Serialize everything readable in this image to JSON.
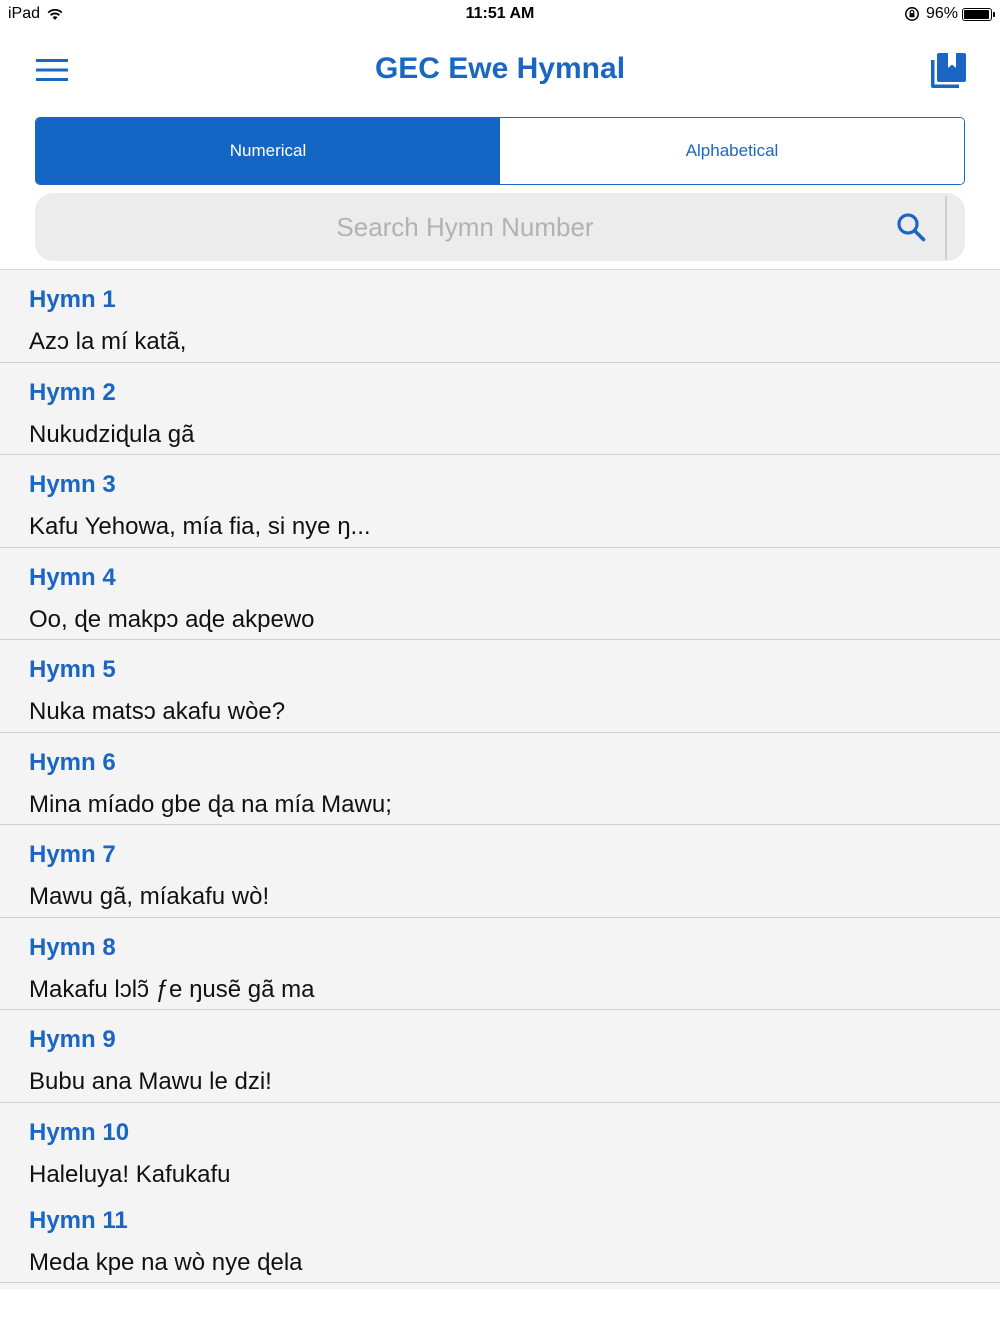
{
  "status_bar": {
    "device": "iPad",
    "time": "11:51 AM",
    "battery_percent": "96%",
    "battery_level": 0.96
  },
  "nav": {
    "title": "GEC Ewe Hymnal",
    "menu_icon": "hamburger-menu-icon",
    "bookmarks_icon": "bookmarks-icon"
  },
  "segments": {
    "numerical": "Numerical",
    "alphabetical": "Alphabetical",
    "selected": "numerical"
  },
  "search": {
    "placeholder": "Search Hymn Number",
    "value": ""
  },
  "colors": {
    "accent": "#1a66c2",
    "segment_active": "#1565c4",
    "list_background": "#f4f4f4",
    "search_background": "#ececec"
  },
  "hymns": [
    {
      "number": "Hymn 1",
      "first_line": "Azɔ la mí katã,"
    },
    {
      "number": "Hymn 2",
      "first_line": "Nukudziɖula gã"
    },
    {
      "number": "Hymn 3",
      "first_line": "Kafu Yehowa, mía fia, si nye ŋ..."
    },
    {
      "number": "Hymn 4",
      "first_line": "Oo, ɖe makpɔ aɖe akpewo"
    },
    {
      "number": "Hymn 5",
      "first_line": "Nuka matsɔ akafu wòe?"
    },
    {
      "number": "Hymn 6",
      "first_line": "Mina míado gbe ɖa na mía Mawu;"
    },
    {
      "number": "Hymn 7",
      "first_line": "Mawu gã, míakafu wò!"
    },
    {
      "number": "Hymn 8",
      "first_line": "Makafu lɔlɔ̃ ƒe ŋusẽ gã ma"
    },
    {
      "number": "Hymn 9",
      "first_line": "Bubu ana Mawu le dzi!"
    },
    {
      "number": "Hymn 10",
      "first_line": "Haleluya! Kafukafu"
    },
    {
      "number": "Hymn 11",
      "first_line": "Meda kpe na wò nye ɖela"
    }
  ]
}
